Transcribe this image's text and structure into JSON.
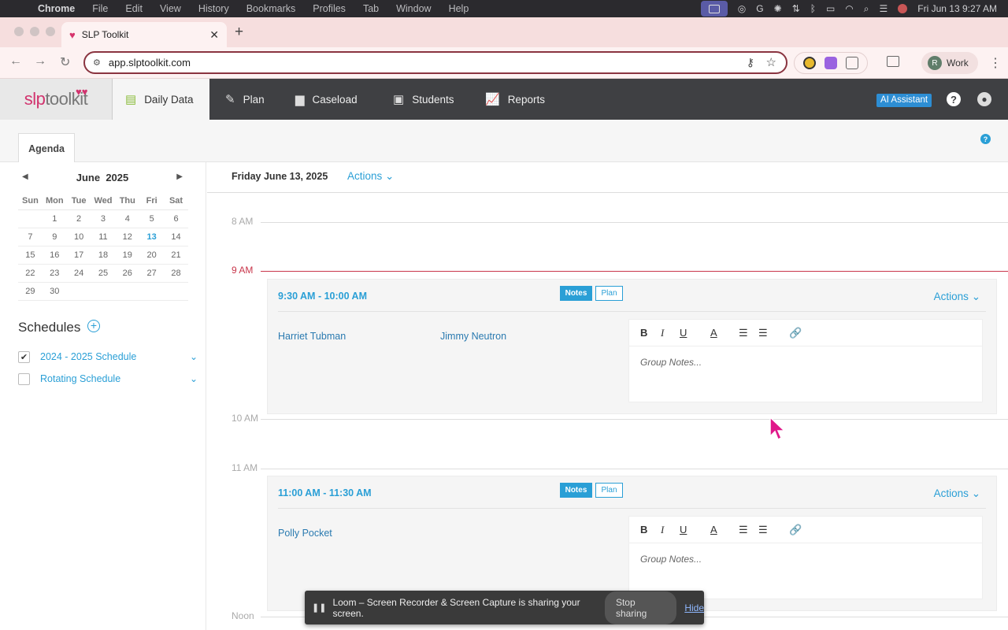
{
  "menubar": {
    "app": "Chrome",
    "items": [
      "File",
      "Edit",
      "View",
      "History",
      "Bookmarks",
      "Profiles",
      "Tab",
      "Window",
      "Help"
    ],
    "clock": "Fri Jun 13  9:27 AM"
  },
  "browser": {
    "tab_title": "SLP Toolkit",
    "url": "app.slptoolkit.com",
    "profile_initial": "R",
    "profile_name": "Work"
  },
  "app": {
    "logo_slp": "slp",
    "logo_toolkit": "toolkit",
    "nav": [
      {
        "label": "Daily Data",
        "icon": "clipboard-icon",
        "active": true
      },
      {
        "label": "Plan",
        "icon": "pencil-icon"
      },
      {
        "label": "Caseload",
        "icon": "briefcase-icon"
      },
      {
        "label": "Students",
        "icon": "id-badge-icon"
      },
      {
        "label": "Reports",
        "icon": "line-chart-icon"
      }
    ],
    "ai_assistant": "AI Assistant",
    "help": "?"
  },
  "subbar": {
    "agenda_tab": "Agenda",
    "help": "?"
  },
  "calendar": {
    "month": "June",
    "year": "2025",
    "weekdays": [
      "Sun",
      "Mon",
      "Tue",
      "Wed",
      "Thu",
      "Fri",
      "Sat"
    ],
    "weeks": [
      [
        "",
        "1",
        "2",
        "3",
        "4",
        "5",
        "6",
        "7"
      ],
      [
        "8",
        "9",
        "10",
        "11",
        "12",
        "13",
        "14"
      ],
      [
        "15",
        "16",
        "17",
        "18",
        "19",
        "20",
        "21"
      ],
      [
        "22",
        "23",
        "24",
        "25",
        "26",
        "27",
        "28"
      ],
      [
        "29",
        "30",
        "",
        "",
        "",
        "",
        ""
      ]
    ],
    "today": "13"
  },
  "schedules": {
    "title": "Schedules",
    "items": [
      {
        "label": "2024 - 2025 Schedule",
        "checked": true
      },
      {
        "label": "Rotating Schedule",
        "checked": false
      }
    ]
  },
  "day": {
    "date": "Friday June 13, 2025",
    "actions": "Actions",
    "hours": [
      "8 AM",
      "9 AM",
      "10 AM",
      "11 AM",
      "Noon"
    ],
    "events": [
      {
        "time": "9:30 AM - 10:00 AM",
        "notes": "Notes",
        "plan": "Plan",
        "actions": "Actions",
        "students": [
          "Harriet Tubman",
          "Jimmy Neutron"
        ],
        "placeholder": "Group Notes..."
      },
      {
        "time": "11:00 AM - 11:30 AM",
        "notes": "Notes",
        "plan": "Plan",
        "actions": "Actions",
        "students": [
          "Polly Pocket"
        ],
        "placeholder": "Group Notes..."
      }
    ]
  },
  "editor_toolbar": {
    "bold": "B",
    "italic": "I",
    "underline": "U",
    "color": "A"
  },
  "loom": {
    "message": "Loom – Screen Recorder & Screen Capture is sharing your screen.",
    "stop": "Stop sharing",
    "hide": "Hide"
  }
}
